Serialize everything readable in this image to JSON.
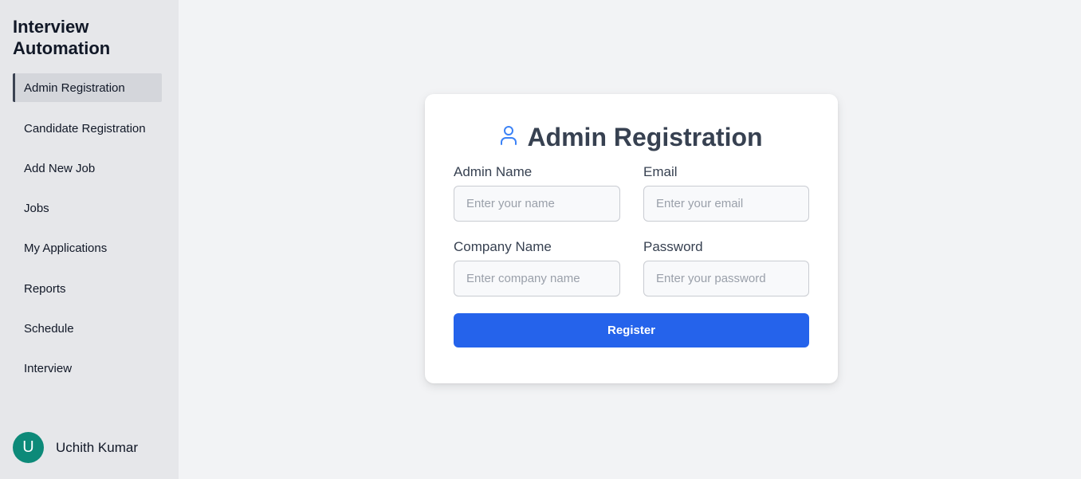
{
  "app": {
    "title": "Interview Automation"
  },
  "sidebar": {
    "items": [
      {
        "label": "Admin Registration",
        "active": true
      },
      {
        "label": "Candidate Registration",
        "active": false
      },
      {
        "label": "Add New Job",
        "active": false
      },
      {
        "label": "Jobs",
        "active": false
      },
      {
        "label": "My Applications",
        "active": false
      },
      {
        "label": "Reports",
        "active": false
      },
      {
        "label": "Schedule",
        "active": false
      },
      {
        "label": "Interview",
        "active": false
      }
    ]
  },
  "user": {
    "initial": "U",
    "name": "Uchith Kumar",
    "avatar_color": "#0d8a79"
  },
  "form": {
    "title": "Admin Registration",
    "icon": "user-icon",
    "fields": {
      "admin_name": {
        "label": "Admin Name",
        "placeholder": "Enter your name",
        "value": ""
      },
      "email": {
        "label": "Email",
        "placeholder": "Enter your email",
        "value": ""
      },
      "company_name": {
        "label": "Company Name",
        "placeholder": "Enter company name",
        "value": ""
      },
      "password": {
        "label": "Password",
        "placeholder": "Enter your password",
        "value": ""
      }
    },
    "submit_label": "Register"
  },
  "colors": {
    "accent": "#2563eb",
    "icon": "#3b82f6",
    "sidebar_bg": "#e6e7ea",
    "page_bg": "#f2f3f5"
  }
}
